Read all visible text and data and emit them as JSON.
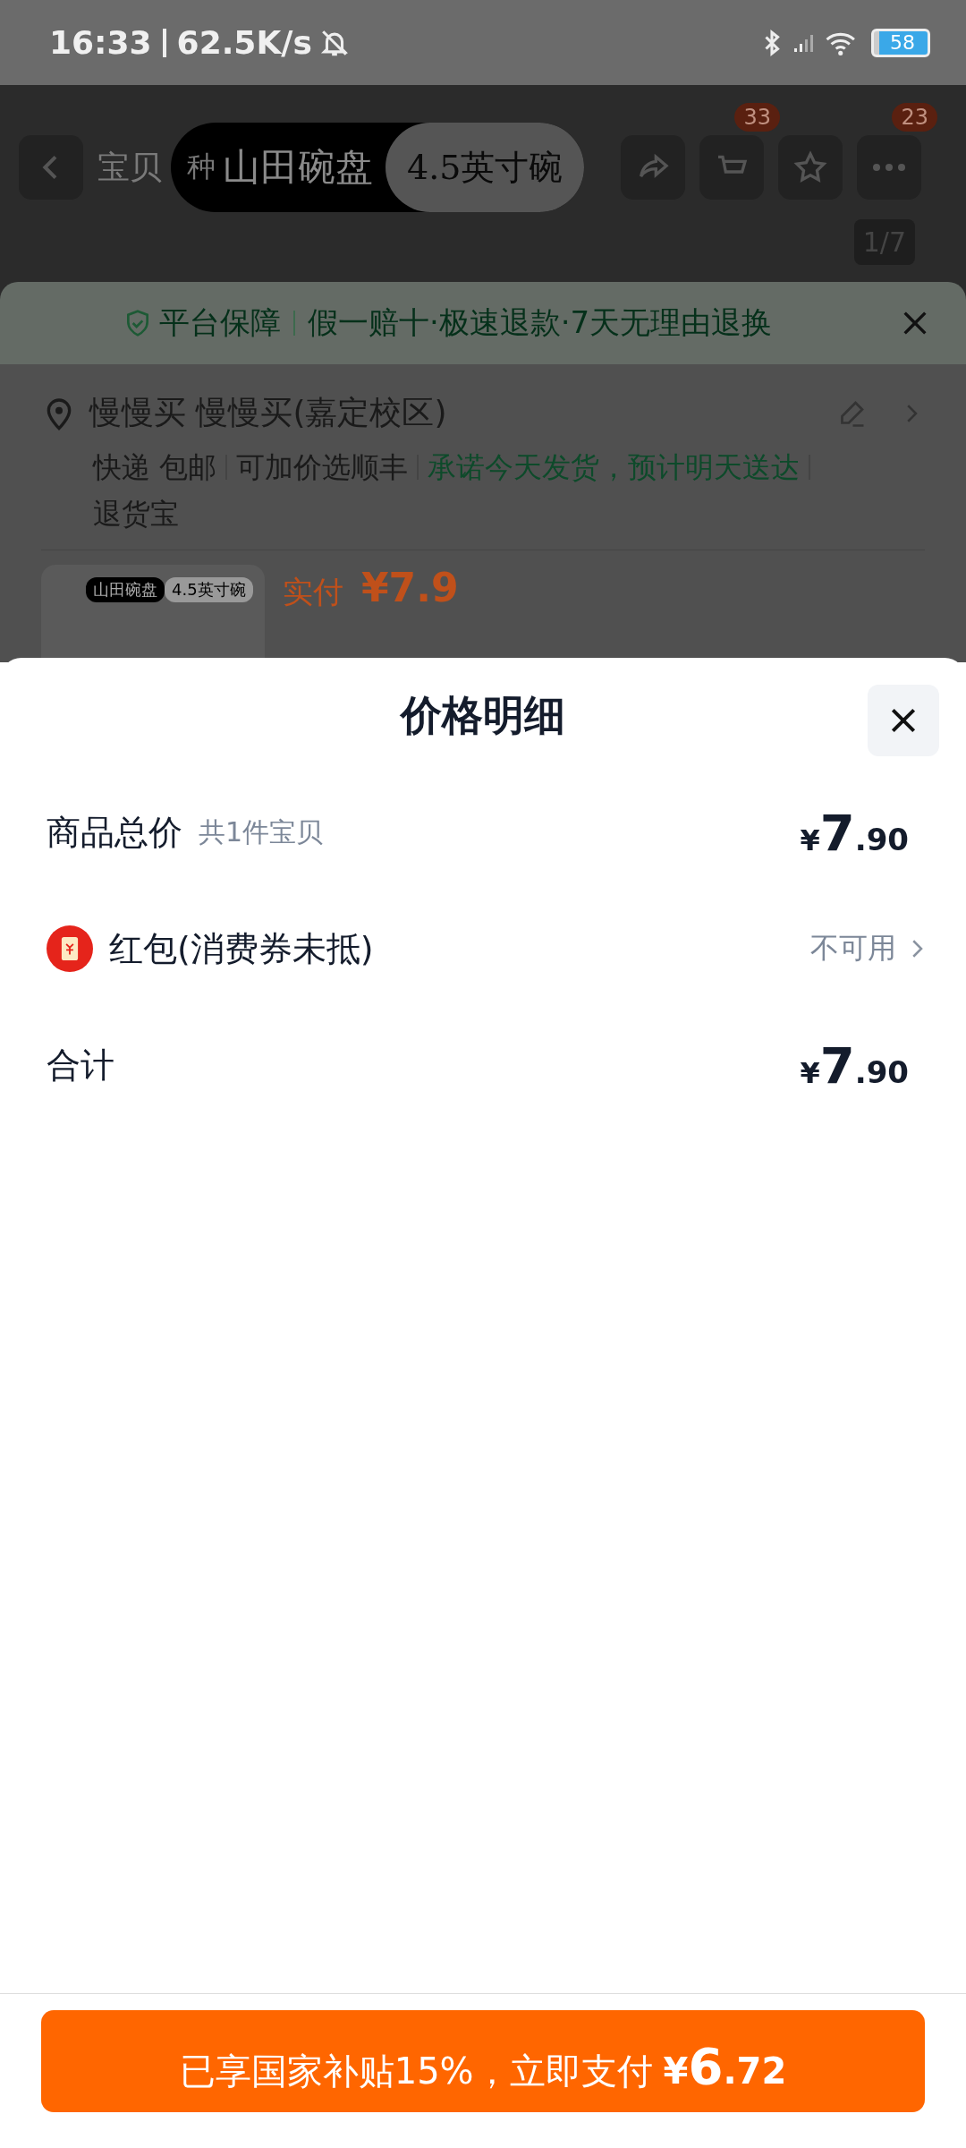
{
  "status_bar": {
    "time": "16:33",
    "speed": "62.5K/s",
    "battery": "58"
  },
  "header": {
    "tab": "宝贝",
    "pill_prefix": "种",
    "pill_title": "山田碗盘",
    "pill_size": "4.5英寸碗",
    "cart_badge": "33",
    "more_badge": "23",
    "image_counter": "1/7"
  },
  "guarantee": {
    "label": "平台保障",
    "text": "假一赔十·极速退款·7天无理由退换"
  },
  "address": {
    "name": "慢慢买 慢慢买(嘉定校区)",
    "shipping": [
      {
        "text": "快递 包邮",
        "kind": "plain"
      },
      {
        "text": "可加价选顺丰",
        "kind": "plain"
      },
      {
        "text": "承诺今天发货，预计明天送达",
        "kind": "promise"
      },
      {
        "text": "退货宝",
        "kind": "plain"
      }
    ]
  },
  "product": {
    "thumb_title": "山田碗盘",
    "thumb_size": "4.5英寸碗",
    "paid_label": "实付",
    "paid_price": "¥7.9"
  },
  "sheet": {
    "title": "价格明细",
    "rows": [
      {
        "kind": "price",
        "label": "商品总价",
        "note": "共1件宝贝",
        "currency": "¥",
        "integer": "7",
        "decimal": ".90"
      },
      {
        "kind": "link",
        "label": "红包(消费券未抵)",
        "value": "不可用"
      },
      {
        "kind": "price",
        "label": "合计",
        "currency": "¥",
        "integer": "7",
        "decimal": ".90"
      }
    ]
  },
  "pay_button": {
    "text": "已享国家补贴15%，立即支付",
    "currency": "¥",
    "integer": "6",
    "decimal": ".72"
  }
}
